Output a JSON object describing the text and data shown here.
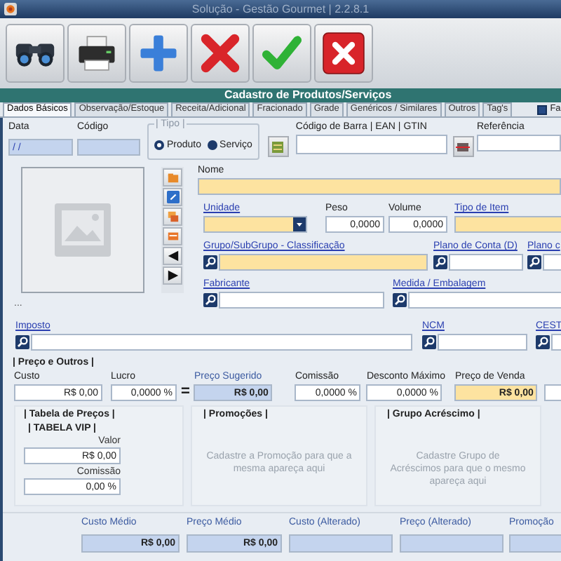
{
  "window": {
    "title": "Solução - Gestão Gourmet | 2.2.8.1"
  },
  "toolbar": [
    {
      "kind": "search"
    },
    {
      "kind": "print"
    },
    {
      "kind": "new"
    },
    {
      "kind": "delete"
    },
    {
      "kind": "save"
    },
    {
      "kind": "close"
    }
  ],
  "header": "Cadastro de Produtos/Serviços",
  "tabs": [
    {
      "label": "Dados Básicos",
      "selected": true
    },
    {
      "label": "Observação/Estoque",
      "selected": false
    },
    {
      "label": "Receita/Adicional",
      "selected": false
    },
    {
      "label": "Fracionado",
      "selected": false
    },
    {
      "label": "Grade",
      "selected": false
    },
    {
      "label": "Genéricos / Similares",
      "selected": false
    },
    {
      "label": "Outros",
      "selected": false
    },
    {
      "label": "Tag's",
      "selected": false
    }
  ],
  "tab_bar_option": {
    "label": "Fa",
    "checked": true
  },
  "top_row": {
    "data": {
      "label": "Data",
      "value": "/ /"
    },
    "codigo": {
      "label": "Código"
    },
    "tipo": {
      "title": "| Tipo |",
      "options": [
        {
          "label": "Produto",
          "selected": true
        },
        {
          "label": "Serviço",
          "selected": false
        }
      ]
    },
    "codigo_barra": {
      "label": "Código de Barra | EAN | GTIN"
    },
    "referencia": {
      "label": "Referência"
    }
  },
  "image_more": "...",
  "side_buttons": [
    {
      "kind": "folder"
    },
    {
      "kind": "link"
    },
    {
      "kind": "stack"
    },
    {
      "kind": "tray"
    },
    {
      "kind": "prev"
    },
    {
      "kind": "next"
    }
  ],
  "product_rows": [
    [
      {
        "label": "Nome",
        "link": false,
        "kind": "required"
      }
    ],
    [
      {
        "label": "Unidade",
        "link": true,
        "kind": "required",
        "dropdown": true
      },
      {
        "label": "Peso",
        "link": false,
        "kind": "normal",
        "value": "0,0000"
      },
      {
        "label": "Volume",
        "link": false,
        "kind": "normal",
        "value": "0,0000"
      },
      {
        "label": "Tipo de Item",
        "link": true,
        "kind": "required"
      }
    ],
    [
      {
        "label": "Grupo/SubGrupo - Classificação",
        "link": true,
        "kind": "required",
        "lookup": true
      },
      {
        "label": "Plano de Conta (D)",
        "link": true,
        "kind": "normal",
        "lookup": true
      },
      {
        "label": "Plano c",
        "link": true,
        "kind": "normal",
        "lookup": true
      }
    ],
    [
      {
        "label": "Fabricante",
        "link": true,
        "kind": "normal",
        "lookup": true
      },
      {
        "label": "Medida / Embalagem",
        "link": true,
        "kind": "normal",
        "lookup": true
      }
    ]
  ],
  "tax_row": [
    {
      "label": "Imposto",
      "link": true,
      "lookup": true
    },
    {
      "label": "NCM",
      "link": true,
      "lookup": true
    },
    {
      "label": "CEST",
      "link": true,
      "lookup": true
    }
  ],
  "price_section": {
    "title": "| Preço e Outros |",
    "equals": "=",
    "fields": [
      {
        "label": "Custo",
        "kind": "normal",
        "value": "R$ 0,00"
      },
      {
        "label": "Lucro",
        "kind": "normal",
        "value": "0,0000 %"
      },
      {
        "label": "Preço Sugerido",
        "kind": "readonly",
        "value": "R$ 0,00"
      },
      {
        "label": "Comissão",
        "kind": "normal",
        "value": "0,0000 %"
      },
      {
        "label": "Desconto Máximo",
        "kind": "normal",
        "value": "0,0000 %"
      },
      {
        "label": "Preço de Venda",
        "kind": "required",
        "value": "R$ 0,00"
      },
      {
        "kind": "normal"
      }
    ]
  },
  "price_tables": {
    "title": "| Tabela de Preços |",
    "table": {
      "name": "| TABELA VIP |",
      "fields": [
        {
          "label": "Valor",
          "value": "R$ 0,00"
        },
        {
          "label": "Comissão",
          "value": "0,00 %"
        }
      ]
    }
  },
  "promotions": {
    "title": "| Promoções |",
    "message": "Cadastre a Promoção para que a mesma apareça aqui"
  },
  "surcharge_groups": {
    "title": "| Grupo Acréscimo |",
    "message": "Cadastre Grupo de Acréscimos para que o mesmo apareça aqui"
  },
  "summary": [
    {
      "label": "Custo Médio",
      "kind": "readonly",
      "value": "R$ 0,00"
    },
    {
      "label": "Preço Médio",
      "kind": "readonly",
      "value": "R$ 0,00"
    },
    {
      "label": "Custo (Alterado)",
      "kind": "readonly"
    },
    {
      "label": "Preço (Alterado)",
      "kind": "readonly"
    },
    {
      "label": "Promoção",
      "kind": "readonly"
    }
  ]
}
